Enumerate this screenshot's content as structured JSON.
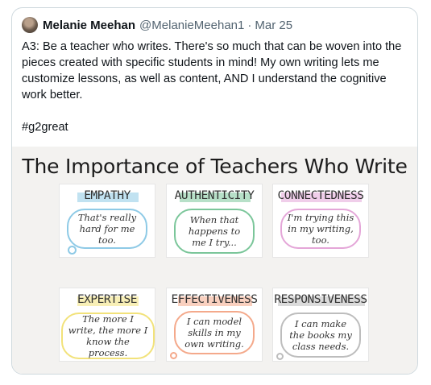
{
  "tweet": {
    "author_name": "Melanie Meehan",
    "author_handle": "@MelanieMeehan1",
    "separator": "·",
    "date": "Mar 25",
    "body": "A3: Be a teacher who writes. There's so much that can be woven into the pieces created with specific students in mind! My own writing lets me customize lessons, as well as content, AND I understand the cognitive work better.",
    "hashtag": "#g2great"
  },
  "image": {
    "title": "The Importance of Teachers Who Write",
    "panels": [
      {
        "heading": "EMPATHY",
        "quote": "That's really hard for me too.",
        "color": "#8ecae6"
      },
      {
        "heading": "AUTHENTICITY",
        "quote": "When that happens to me I try...",
        "color": "#7bc69a"
      },
      {
        "heading": "CONNECTEDNESS",
        "quote": "I'm trying this in my writing, too.",
        "color": "#e4a6d8"
      },
      {
        "heading": "EXPERTISE",
        "quote": "The more I write, the more I know the process.",
        "color": "#f2e27a"
      },
      {
        "heading": "EFFECTIVENESS",
        "quote": "I can model skills in my own writing.",
        "color": "#f4a98b"
      },
      {
        "heading": "RESPONSIVENESS",
        "quote": "I can make the books my class needs.",
        "color": "#bdbdbd"
      }
    ]
  }
}
